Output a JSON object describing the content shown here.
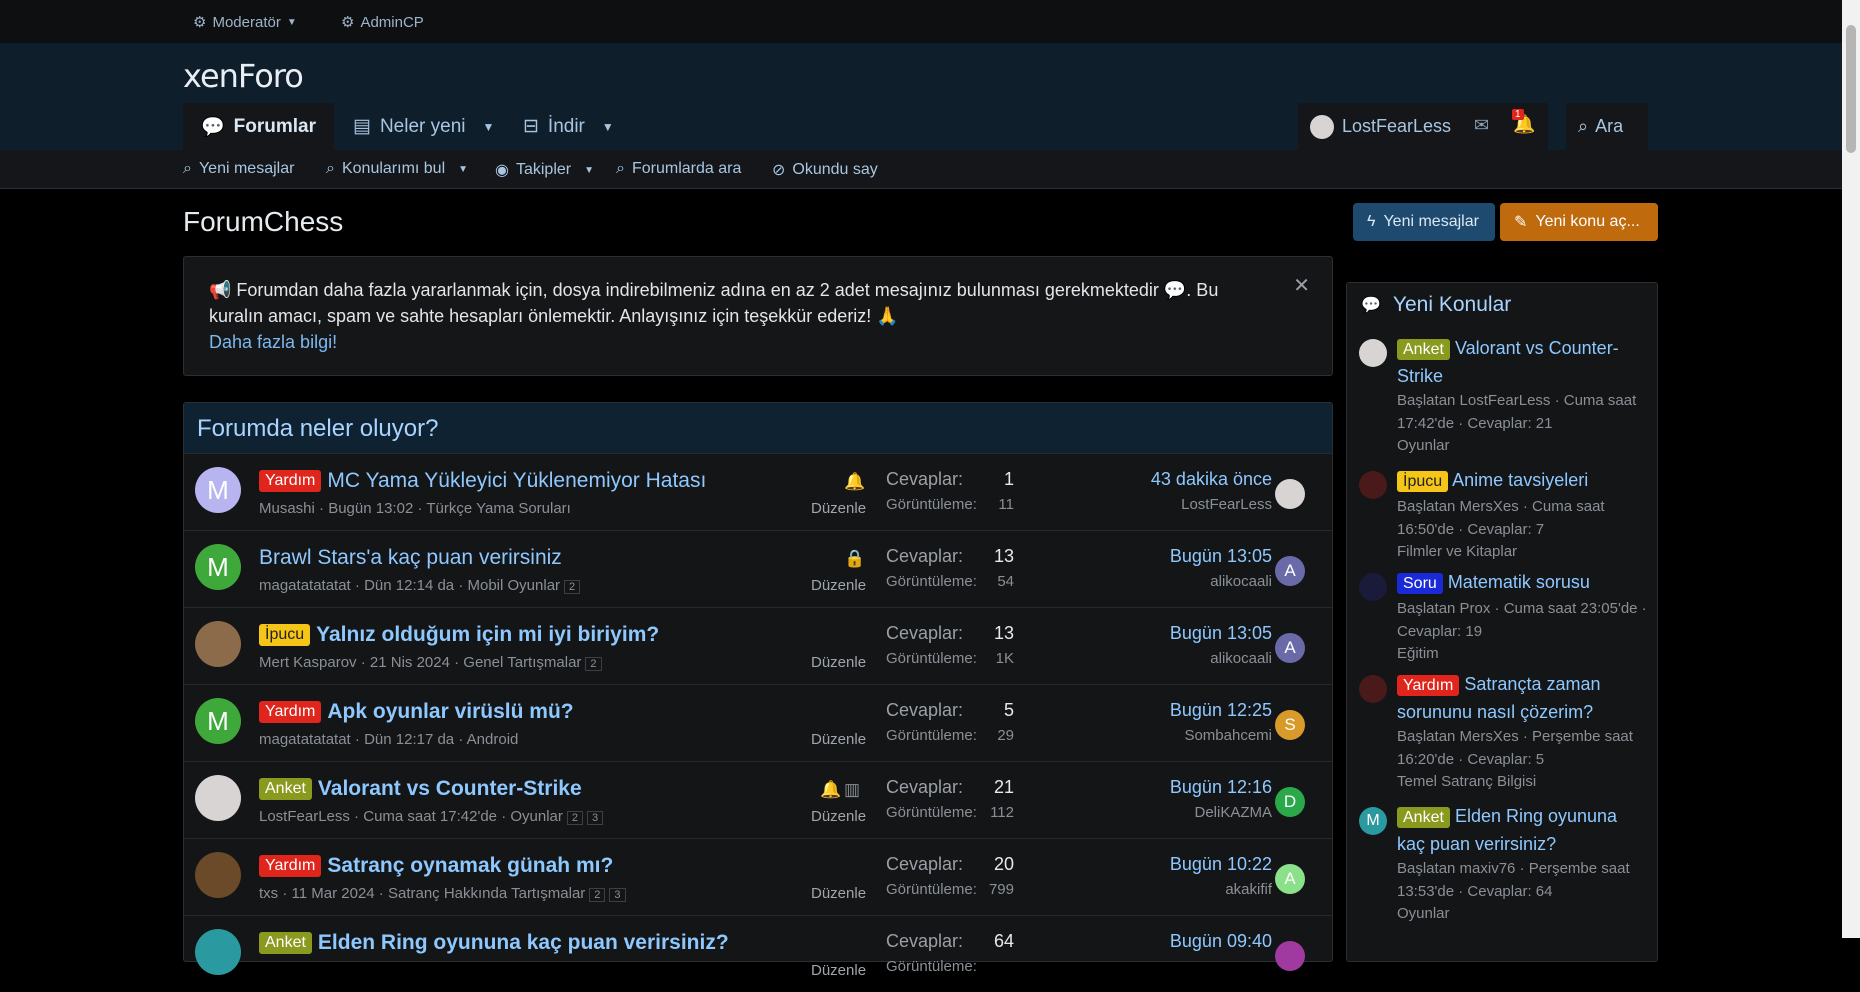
{
  "topbar": {
    "moderator": "Moderatör",
    "admincp": "AdminCP"
  },
  "header": {
    "logo": "xenForo",
    "nav": [
      {
        "label": "Forumlar"
      },
      {
        "label": "Neler yeni"
      },
      {
        "label": "İndir"
      }
    ],
    "user": "LostFearLess",
    "alert_count": "1",
    "search": "Ara"
  },
  "subnav": [
    "Yeni mesajlar",
    "Konularımı bul",
    "Takipler",
    "Forumlarda ara",
    "Okundu say"
  ],
  "page": {
    "title": "ForumChess",
    "btn_new_posts": "Yeni mesajlar",
    "btn_new_thread": "Yeni konu aç..."
  },
  "notice": {
    "line1": "📢 Forumdan daha fazla yararlanmak için, dosya indirebilmeniz adına en az 2 adet mesajınız bulunması gerekmektedir 💬. Bu kuralın amacı, spam ve sahte hesapları önlemektir. Anlayışınız için teşekkür ederiz! 🙏",
    "link": "Daha fazla bilgi!"
  },
  "feed": {
    "title": "Forumda neler oluyor?",
    "replies_label": "Cevaplar:",
    "views_label": "Görüntüleme:",
    "edit_label": "Düzenle",
    "threads": [
      {
        "prefix": "Yardım",
        "prefix_color": "#e0261c",
        "title": "MC Yama Yükleyici Yüklenemiyor Hatası",
        "author": "Musashi",
        "date": "Bugün 13:02",
        "forum": "Türkçe Yama Soruları",
        "pages": [],
        "replies": "1",
        "views": "11",
        "last_time": "43 dakika önce",
        "last_user": "LostFearLess",
        "avatar": "M",
        "avatar_color": "#b7b4f0",
        "last_av": "",
        "last_av_color": "#d9d4d4"
      },
      {
        "prefix": "",
        "prefix_color": "",
        "title": "Brawl Stars'a kaç puan verirsiniz",
        "author": "magatatatatat",
        "date": "Dün 12:14 da",
        "forum": "Mobil Oyunlar",
        "pages": [
          "2"
        ],
        "replies": "13",
        "views": "54",
        "last_time": "Bugün 13:05",
        "last_user": "alikocaali",
        "avatar": "M",
        "avatar_color": "#3fa83a",
        "last_av": "A",
        "last_av_color": "#6a6aa8"
      },
      {
        "prefix": "İpucu",
        "prefix_color": "#f5c518",
        "title": "Yalnız olduğum için mi iyi biriyim?",
        "author": "Mert Kasparov",
        "date": "21 Nis 2024",
        "forum": "Genel Tartışmalar",
        "pages": [
          "2"
        ],
        "replies": "13",
        "views": "1K",
        "last_time": "Bugün 13:05",
        "last_user": "alikocaali",
        "avatar": "",
        "avatar_color": "#8b6b4a",
        "last_av": "A",
        "last_av_color": "#6a6aa8"
      },
      {
        "prefix": "Yardım",
        "prefix_color": "#e0261c",
        "title": "Apk oyunlar virüslü mü?",
        "author": "magatatatatat",
        "date": "Dün 12:17 da",
        "forum": "Android",
        "pages": [],
        "replies": "5",
        "views": "29",
        "last_time": "Bugün 12:25",
        "last_user": "Sombahcemi",
        "avatar": "M",
        "avatar_color": "#3fa83a",
        "last_av": "S",
        "last_av_color": "#d99a2a"
      },
      {
        "prefix": "Anket",
        "prefix_color": "#8a9a1e",
        "title": "Valorant vs Counter-Strike",
        "author": "LostFearLess",
        "date": "Cuma saat 17:42'de",
        "forum": "Oyunlar",
        "pages": [
          "2",
          "3"
        ],
        "replies": "21",
        "views": "112",
        "last_time": "Bugün 12:16",
        "last_user": "DeliKAZMA",
        "avatar": "",
        "avatar_color": "#d9d4d4",
        "last_av": "D",
        "last_av_color": "#2aa84a"
      },
      {
        "prefix": "Yardım",
        "prefix_color": "#e0261c",
        "title": "Satranç oynamak günah mı?",
        "author": "txs",
        "date": "11 Mar 2024",
        "forum": "Satranç Hakkında Tartışmalar",
        "pages": [
          "2",
          "3"
        ],
        "replies": "20",
        "views": "799",
        "last_time": "Bugün 10:22",
        "last_user": "akakifif",
        "avatar": "",
        "avatar_color": "#6b4a2a",
        "last_av": "A",
        "last_av_color": "#8be08a"
      },
      {
        "prefix": "Anket",
        "prefix_color": "#8a9a1e",
        "title": "Elden Ring oyununa kaç puan verirsiniz?",
        "author": "",
        "date": "",
        "forum": "",
        "pages": [],
        "replies": "64",
        "views": "",
        "last_time": "Bugün 09:40",
        "last_user": "",
        "avatar": "",
        "avatar_color": "#2a9aa0",
        "last_av": "",
        "last_av_color": "#a03aa0"
      }
    ]
  },
  "sidebar": {
    "title": "Yeni Konular",
    "items": [
      {
        "prefix": "Anket",
        "prefix_color": "#8a9a1e",
        "title": "Valorant vs Counter-Strike",
        "meta": "Başlatan LostFearLess · Cuma saat 17:42'de · Cevaplar: 21",
        "forum": "Oyunlar",
        "av": "",
        "av_color": "#d9d4d4"
      },
      {
        "prefix": "İpucu",
        "prefix_color": "#f5c518",
        "title": "Anime tavsiyeleri",
        "meta": "Başlatan MersXes · Cuma saat 16:50'de · Cevaplar: 7",
        "forum": "Filmler ve Kitaplar",
        "av": "",
        "av_color": "#4a1a1a"
      },
      {
        "prefix": "Soru",
        "prefix_color": "#1a2ad8",
        "title": "Matematik sorusu",
        "meta": "Başlatan Prox · Cuma saat 23:05'de · Cevaplar: 19",
        "forum": "Eğitim",
        "av": "",
        "av_color": "#1a1a3a"
      },
      {
        "prefix": "Yardım",
        "prefix_color": "#e0261c",
        "title": "Satrançta zaman sorununu nasıl çözerim?",
        "meta": "Başlatan MersXes · Perşembe saat 16:20'de · Cevaplar: 5",
        "forum": "Temel Satranç Bilgisi",
        "av": "",
        "av_color": "#4a1a1a"
      },
      {
        "prefix": "Anket",
        "prefix_color": "#8a9a1e",
        "title": "Elden Ring oyununa kaç puan verirsiniz?",
        "meta": "Başlatan maxiv76 · Perşembe saat 13:53'de · Cevaplar: 64",
        "forum": "Oyunlar",
        "av": "M",
        "av_color": "#2a9aa0"
      }
    ]
  }
}
